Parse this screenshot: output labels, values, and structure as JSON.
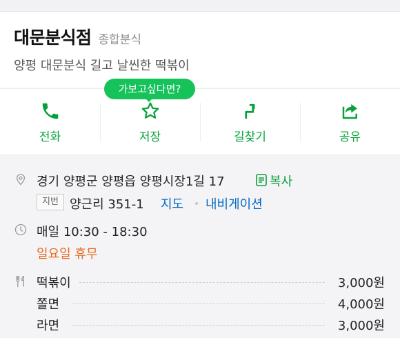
{
  "place": {
    "name": "대문분식점",
    "category": "종합분식",
    "description": "양평 대문분식 길고 날씬한 떡볶이"
  },
  "actions": [
    {
      "label": "전화",
      "icon": "phone-icon"
    },
    {
      "label": "저장",
      "icon": "star-icon"
    },
    {
      "label": "길찾기",
      "icon": "directions-icon"
    },
    {
      "label": "공유",
      "icon": "share-icon"
    }
  ],
  "tooltip": "가보고싶다면?",
  "address": {
    "road": "경기 양평군 양평읍 양평시장1길 17",
    "copy_label": "복사",
    "jibun_badge": "지번",
    "jibun": "양근리 351-1",
    "map_link": "지도",
    "navigation_link": "내비게이션"
  },
  "hours": {
    "time": "매일 10:30 - 18:30",
    "holiday": "일요일 휴무"
  },
  "menu": [
    {
      "name": "떡볶이",
      "price": "3,000원"
    },
    {
      "name": "쫄면",
      "price": "4,000원"
    },
    {
      "name": "라면",
      "price": "3,000원"
    }
  ],
  "colors": {
    "accent_green": "#06a13a",
    "tooltip_green": "#16c35a",
    "link_blue": "#0068c3",
    "holiday_orange": "#e8681e"
  }
}
